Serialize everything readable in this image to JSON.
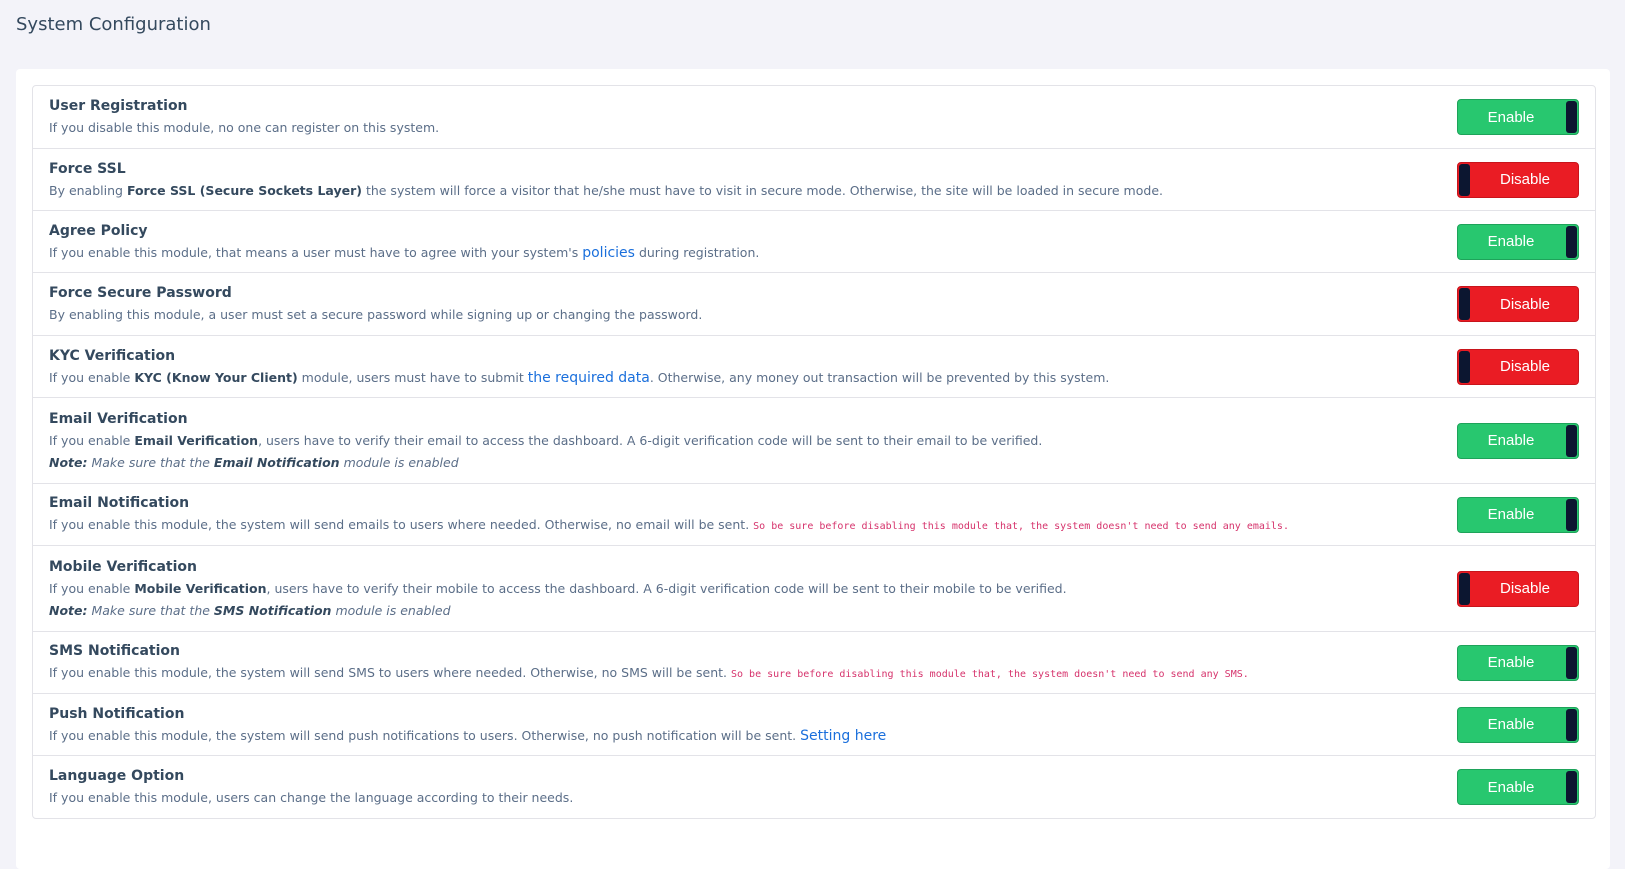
{
  "page": {
    "title": "System Configuration"
  },
  "states": {
    "on": "Enable",
    "off": "Disable"
  },
  "rows": [
    {
      "title": "User Registration",
      "desc": "If you disable this module, no one can register on this system.",
      "state": "Enable"
    },
    {
      "title": "Force SSL",
      "desc_pre": "By enabling ",
      "desc_bold": "Force SSL (Secure Sockets Layer)",
      "desc_post": " the system will force a visitor that he/she must have to visit in secure mode. Otherwise, the site will be loaded in secure mode.",
      "state": "Disable"
    },
    {
      "title": "Agree Policy",
      "desc_pre": "If you enable this module, that means a user must have to agree with your system's ",
      "link": "policies",
      "desc_post": " during registration.",
      "state": "Enable"
    },
    {
      "title": "Force Secure Password",
      "desc": "By enabling this module, a user must set a secure password while signing up or changing the password.",
      "state": "Disable"
    },
    {
      "title": "KYC Verification",
      "desc_pre": "If you enable ",
      "desc_bold": "KYC (Know Your Client)",
      "desc_mid": " module, users must have to submit ",
      "link": "the required data",
      "desc_post": ". Otherwise, any money out transaction will be prevented by this system.",
      "state": "Disable"
    },
    {
      "title": "Email Verification",
      "desc_pre": "If you enable ",
      "desc_bold": "Email Verification",
      "desc_post": ", users have to verify their email to access the dashboard. A 6-digit verification code will be sent to their email to be verified.",
      "note_label": "Note:",
      "note_pre": " Make sure that the ",
      "note_bold": "Email Notification",
      "note_post": " module is enabled",
      "state": "Enable"
    },
    {
      "title": "Email Notification",
      "desc": "If you enable this module, the system will send emails to users where needed. Otherwise, no email will be sent. ",
      "code": "So be sure before disabling this module that, the system doesn't need to send any emails.",
      "state": "Enable"
    },
    {
      "title": "Mobile Verification",
      "desc_pre": "If you enable ",
      "desc_bold": "Mobile Verification",
      "desc_post": ", users have to verify their mobile to access the dashboard. A 6-digit verification code will be sent to their mobile to be verified.",
      "note_label": "Note:",
      "note_pre": " Make sure that the ",
      "note_bold": "SMS Notification",
      "note_post": " module is enabled",
      "state": "Disable"
    },
    {
      "title": "SMS Notification",
      "desc": "If you enable this module, the system will send SMS to users where needed. Otherwise, no SMS will be sent. ",
      "code": "So be sure before disabling this module that, the system doesn't need to send any SMS.",
      "state": "Enable"
    },
    {
      "title": "Push Notification",
      "desc": "If you enable this module, the system will send push notifications to users. Otherwise, no push notification will be sent. ",
      "link": "Setting here",
      "state": "Enable"
    },
    {
      "title": "Language Option",
      "desc": "If you enable this module, users can change the language according to their needs.",
      "state": "Enable"
    }
  ]
}
